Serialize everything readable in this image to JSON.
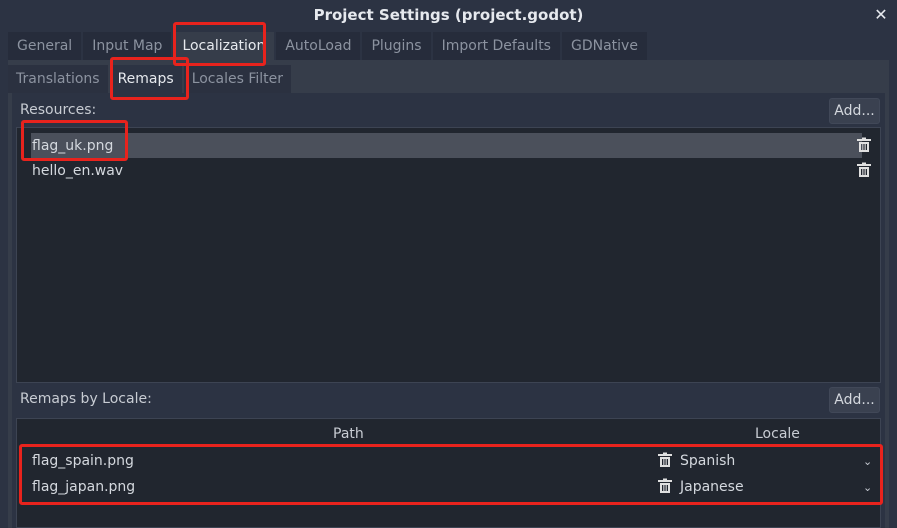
{
  "window": {
    "title": "Project Settings (project.godot)",
    "close_glyph": "✕"
  },
  "main_tabs": [
    {
      "label": "General"
    },
    {
      "label": "Input Map"
    },
    {
      "label": "Localization"
    },
    {
      "label": "AutoLoad"
    },
    {
      "label": "Plugins"
    },
    {
      "label": "Import Defaults"
    },
    {
      "label": "GDNative"
    }
  ],
  "sub_tabs": [
    {
      "label": "Translations"
    },
    {
      "label": "Remaps"
    },
    {
      "label": "Locales Filter"
    }
  ],
  "resources": {
    "label": "Resources:",
    "add_label": "Add...",
    "items": [
      {
        "name": "flag_uk.png",
        "selected": true
      },
      {
        "name": "hello_en.wav",
        "selected": false
      }
    ]
  },
  "remaps": {
    "label": "Remaps by Locale:",
    "add_label": "Add...",
    "columns": {
      "path": "Path",
      "locale": "Locale"
    },
    "rows": [
      {
        "path": "flag_spain.png",
        "locale": "Spanish"
      },
      {
        "path": "flag_japan.png",
        "locale": "Japanese"
      }
    ]
  },
  "colors": {
    "highlight": "#e8231d",
    "background": "#2c3343",
    "list_background": "#21262f"
  },
  "icons": {
    "trash": "trash-icon",
    "close": "close-icon",
    "dropdown": "chevron-down-icon"
  }
}
